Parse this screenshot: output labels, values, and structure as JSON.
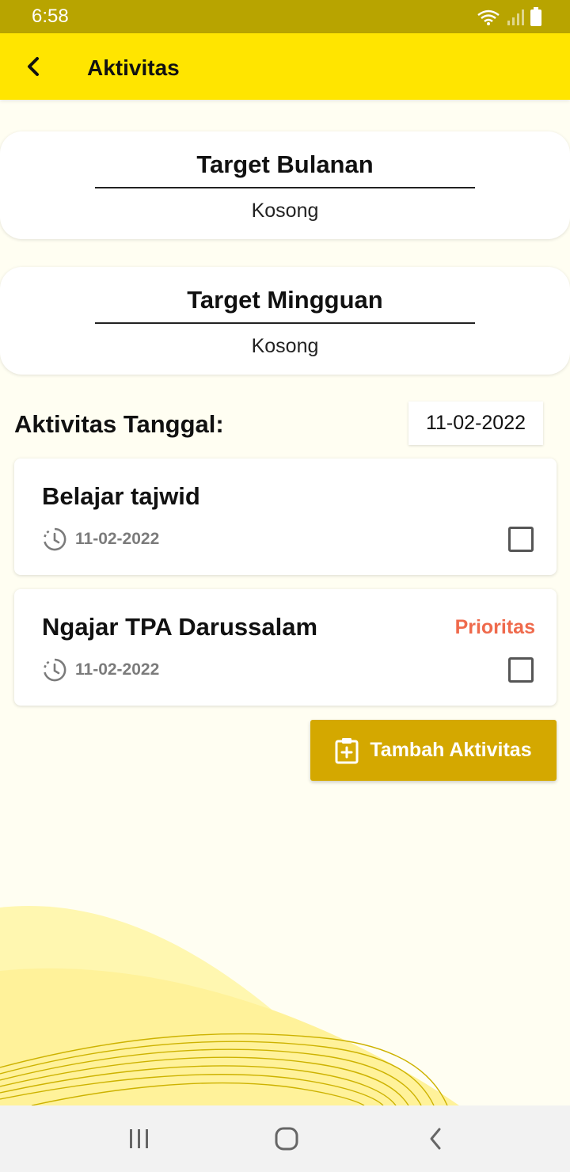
{
  "status_bar": {
    "time": "6:58"
  },
  "header": {
    "title": "Aktivitas"
  },
  "targets": [
    {
      "title": "Target Bulanan",
      "value": "Kosong"
    },
    {
      "title": "Target Mingguan",
      "value": "Kosong"
    }
  ],
  "date_section": {
    "label": "Aktivitas Tanggal:",
    "selected_date": "11-02-2022"
  },
  "activities": [
    {
      "name": "Belajar tajwid",
      "date": "11-02-2022",
      "priority": "",
      "checked": false
    },
    {
      "name": "Ngajar TPA Darussalam",
      "date": "11-02-2022",
      "priority": "Prioritas",
      "checked": false
    }
  ],
  "add_button": {
    "label": "Tambah Aktivitas",
    "icon": "clipboard-plus-icon"
  },
  "colors": {
    "app_bar": "#ffe500",
    "status_bar": "#b8a400",
    "button": "#d4a800",
    "priority": "#ef6a4c"
  },
  "icons": {
    "back": "arrow-left-icon",
    "clock": "clock-history-icon",
    "nav_recent": "recent-apps-icon",
    "nav_home": "home-icon",
    "nav_back": "chevron-left-icon"
  }
}
